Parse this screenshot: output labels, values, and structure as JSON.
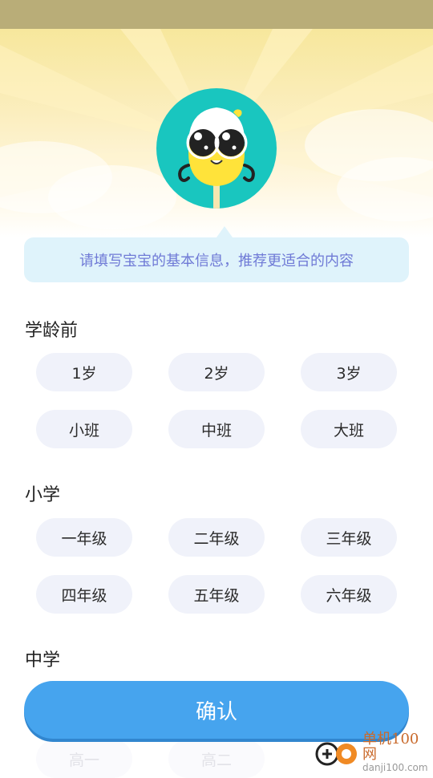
{
  "tooltip": {
    "text": "请填写宝宝的基本信息，推荐更适合的内容"
  },
  "sections": {
    "preschool": {
      "title": "学龄前",
      "options": [
        "1岁",
        "2岁",
        "3岁",
        "小班",
        "中班",
        "大班"
      ]
    },
    "primary": {
      "title": "小学",
      "options": [
        "一年级",
        "二年级",
        "三年级",
        "四年级",
        "五年级",
        "六年级"
      ]
    },
    "middle": {
      "title": "中学",
      "options": [
        "高一",
        "高二"
      ]
    }
  },
  "confirm_label": "确认",
  "watermark": {
    "name": "单机100网",
    "url": "danji100.com"
  },
  "colors": {
    "accent": "#46a4ee",
    "chip_bg": "#f0f2fa",
    "tooltip_bg": "#dff3fb",
    "tooltip_text": "#6f7ad6",
    "avatar_bg": "#19c6bf"
  }
}
